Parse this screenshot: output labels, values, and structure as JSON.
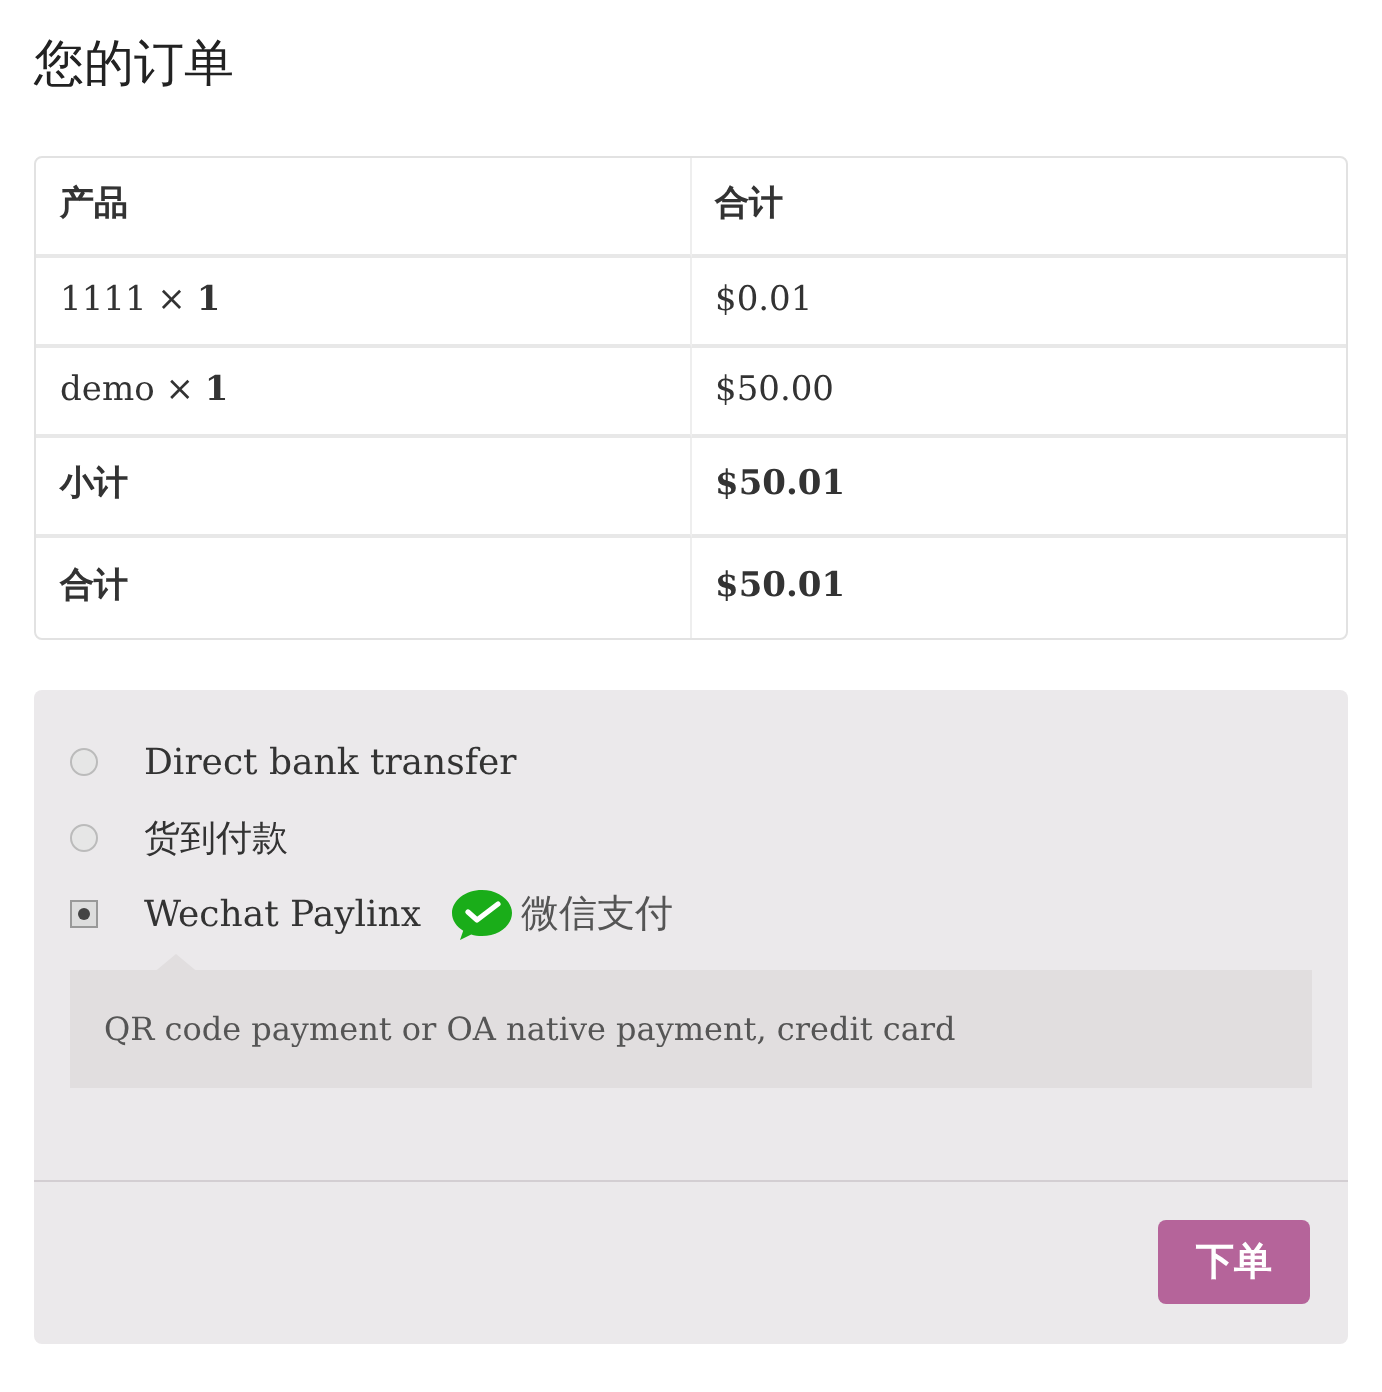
{
  "title": "您的订单",
  "table": {
    "columns": [
      "产品",
      "合计"
    ],
    "rows": [
      {
        "kind": "item",
        "product": "1111  × **1**",
        "total": "$0.01"
      },
      {
        "kind": "item",
        "product": "demo  × **1**",
        "total": "$50.00"
      },
      {
        "kind": "summary",
        "product": "小计",
        "total": "$50.01"
      },
      {
        "kind": "summary",
        "product": "合计",
        "total": "$50.01"
      }
    ]
  },
  "payment_methods": [
    {
      "label": "Direct bank transfer",
      "selected": false
    },
    {
      "label": "货到付款",
      "selected": false
    },
    {
      "label": "Wechat Paylinx",
      "selected": true,
      "badge": "微信支付",
      "description": "QR code payment or OA native payment, credit card"
    }
  ],
  "place_order_button": "下单"
}
